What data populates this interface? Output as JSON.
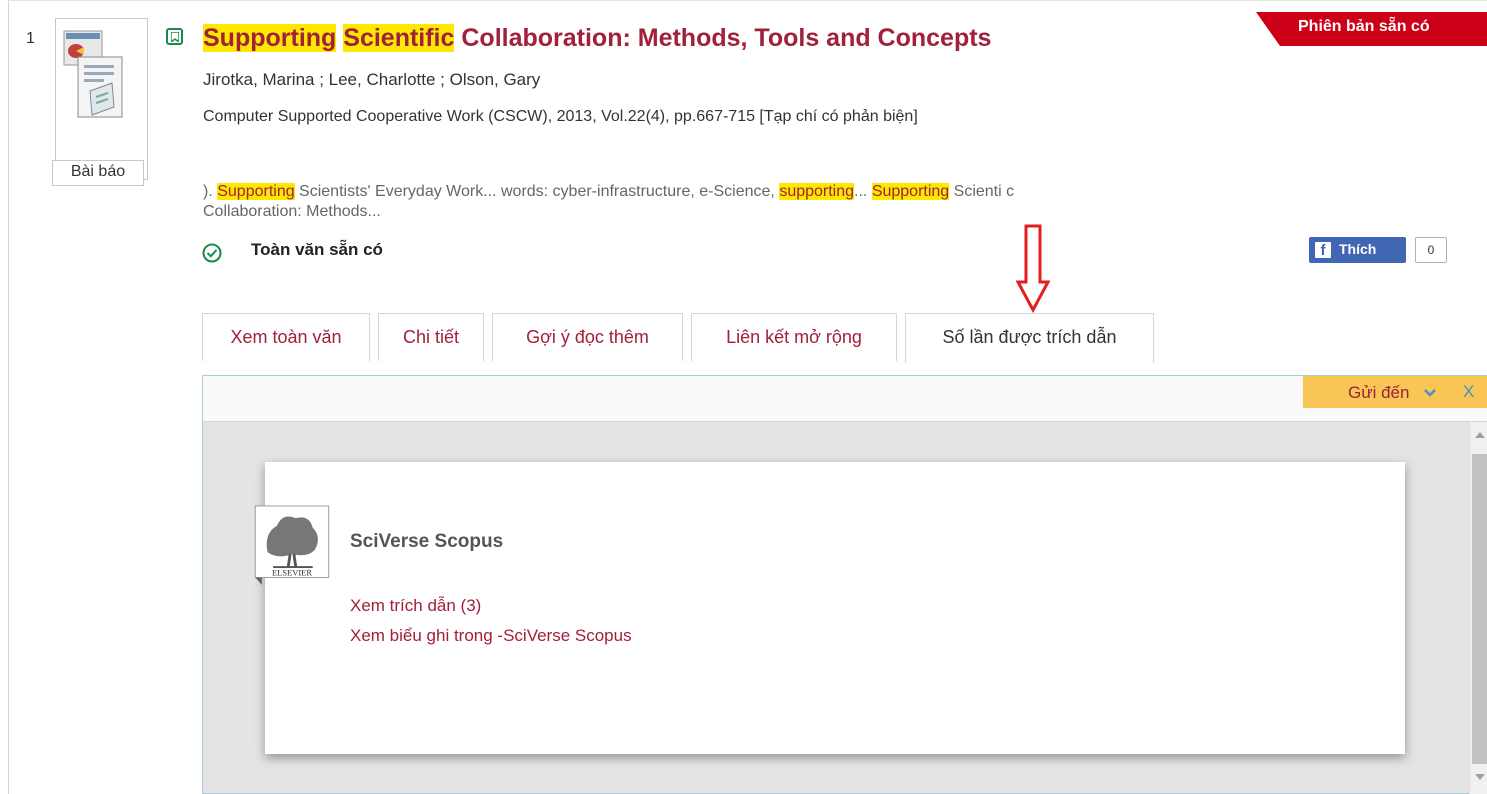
{
  "record": {
    "index": "1",
    "type_label": "Bài báo",
    "title_parts": {
      "hl1": "Supporting",
      "hl2": "Scientific",
      "rest": " Collaboration: Methods, Tools and Concepts"
    },
    "authors": "Jirotka, Marina ; Lee, Charlotte ; Olson, Gary",
    "source": "Computer Supported Cooperative Work (CSCW), 2013, Vol.22(4), pp.667-715 [Tạp chí có phản biện]",
    "snippet": {
      "p1": "). ",
      "h1": "Supporting",
      "p2": " Scientists' Everyday Work... words: cyber-infrastructure, e-Science, ",
      "h2": "supporting",
      "p3": "... ",
      "h3": "Supporting",
      "p4": " Scienti c Collaboration: Methods..."
    },
    "availability": "Toàn văn sẵn có",
    "ribbon": "Phiên bản sẵn có"
  },
  "facebook": {
    "like_label": "Thích",
    "count": "0"
  },
  "tabs": [
    {
      "label": "Xem toàn văn"
    },
    {
      "label": "Chi tiết"
    },
    {
      "label": "Gợi ý đọc thêm"
    },
    {
      "label": "Liên kết mở rộng"
    },
    {
      "label": "Số lần được trích dẫn"
    }
  ],
  "panel": {
    "send_to": "Gửi đến",
    "close": "X",
    "provider_name": "SciVerse Scopus",
    "logo_text": "ELSEVIER",
    "link_citations": "Xem trích dẫn (3)",
    "link_record": "Xem biểu ghi trong -SciVerse Scopus"
  },
  "colors": {
    "accent": "#a1203a",
    "highlight": "#ffe800",
    "ribbon": "#cc0016",
    "sendto_bg": "#f7c654",
    "fb_blue": "#4267b2",
    "avail_green": "#1a8a4c"
  }
}
